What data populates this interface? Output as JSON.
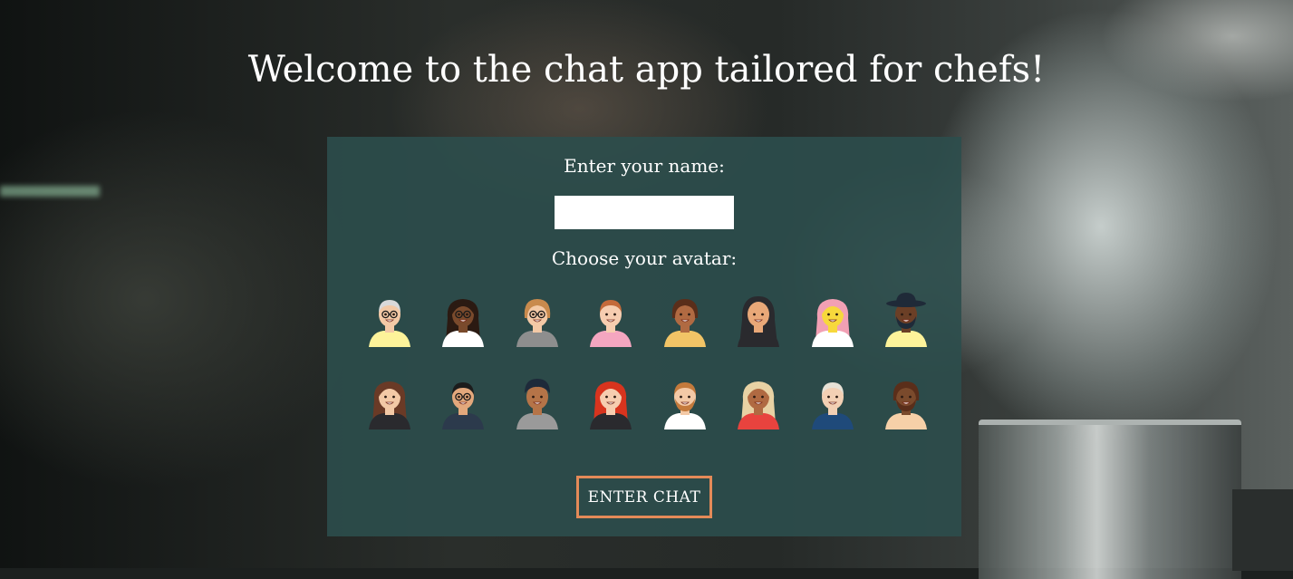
{
  "page": {
    "heading": "Welcome to the chat app tailored for chefs!"
  },
  "form": {
    "name_label": "Enter your name:",
    "name_value": "",
    "avatar_label": "Choose your avatar:",
    "submit_label": "ENTER CHAT"
  },
  "colors": {
    "panel": "#2c4e4d",
    "button_border": "#e48a58"
  },
  "avatars": [
    {
      "name": "avatar-1-icon",
      "skin": "#f3c9a6",
      "hair": "#d9d9d9",
      "shirt": "#fdf39a",
      "hair_style": "short",
      "glasses": true,
      "beard": false
    },
    {
      "name": "avatar-2-icon",
      "skin": "#7a4a2c",
      "hair": "#2b1a12",
      "shirt": "#ffffff",
      "hair_style": "long",
      "glasses": true,
      "beard": false
    },
    {
      "name": "avatar-3-icon",
      "skin": "#f3c9a6",
      "hair": "#c88a4d",
      "shirt": "#8e8e8e",
      "hair_style": "bob",
      "glasses": true,
      "beard": false
    },
    {
      "name": "avatar-4-icon",
      "skin": "#f6cdb0",
      "hair": "#c46a3a",
      "shirt": "#f4a6c0",
      "hair_style": "short",
      "glasses": false,
      "beard": false
    },
    {
      "name": "avatar-5-icon",
      "skin": "#b06a42",
      "hair": "#5a2e1a",
      "shirt": "#f2c466",
      "hair_style": "bob",
      "glasses": false,
      "beard": false
    },
    {
      "name": "avatar-6-icon",
      "skin": "#e9a878",
      "hair": "#2a2a2e",
      "shirt": "#2a2a2e",
      "hair_style": "hijab",
      "glasses": false,
      "beard": false
    },
    {
      "name": "avatar-7-icon",
      "skin": "#f7d83c",
      "hair": "#f2a0b4",
      "shirt": "#ffffff",
      "hair_style": "long",
      "glasses": false,
      "beard": false
    },
    {
      "name": "avatar-8-icon",
      "skin": "#6b3f26",
      "hair": "#1f2a38",
      "shirt": "#fdf39a",
      "hair_style": "hat",
      "glasses": false,
      "beard": true
    },
    {
      "name": "avatar-9-icon",
      "skin": "#f3c9a6",
      "hair": "#6a3a26",
      "shirt": "#2a2a2e",
      "hair_style": "long",
      "glasses": false,
      "beard": false
    },
    {
      "name": "avatar-10-icon",
      "skin": "#e3a87c",
      "hair": "#1c1c1c",
      "shirt": "#2c3a4c",
      "hair_style": "short",
      "glasses": true,
      "beard": false
    },
    {
      "name": "avatar-11-icon",
      "skin": "#b57448",
      "hair": "#1e2a3a",
      "shirt": "#9a9a9a",
      "hair_style": "turban",
      "glasses": false,
      "beard": false
    },
    {
      "name": "avatar-12-icon",
      "skin": "#f6cdb0",
      "hair": "#d8341e",
      "shirt": "#2a2a2e",
      "hair_style": "long",
      "glasses": false,
      "beard": false
    },
    {
      "name": "avatar-13-icon",
      "skin": "#f3c9a6",
      "hair": "#c47a3c",
      "shirt": "#ffffff",
      "hair_style": "short",
      "glasses": false,
      "beard": true
    },
    {
      "name": "avatar-14-icon",
      "skin": "#b06a42",
      "hair": "#e8d2a4",
      "shirt": "#e8433e",
      "hair_style": "long",
      "glasses": false,
      "beard": false
    },
    {
      "name": "avatar-15-icon",
      "skin": "#f3d0b4",
      "hair": "#e8e2d6",
      "shirt": "#1f4a7a",
      "hair_style": "short",
      "glasses": false,
      "beard": false
    },
    {
      "name": "avatar-16-icon",
      "skin": "#7a4a2c",
      "hair": "#5a2e1a",
      "shirt": "#f6d0a8",
      "hair_style": "bob",
      "glasses": false,
      "beard": true
    }
  ]
}
